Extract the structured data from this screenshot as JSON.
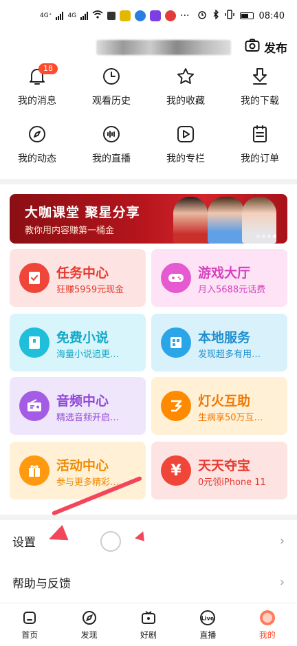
{
  "status_bar": {
    "network_1": "4G⁺",
    "network_2": "4G",
    "time": "08:40"
  },
  "header": {
    "publish_label": "发布"
  },
  "quick_actions": [
    {
      "label": "我的消息",
      "icon": "bell-icon",
      "badge": "18"
    },
    {
      "label": "观看历史",
      "icon": "clock-icon"
    },
    {
      "label": "我的收藏",
      "icon": "star-icon"
    },
    {
      "label": "我的下载",
      "icon": "download-icon"
    },
    {
      "label": "我的动态",
      "icon": "compass-icon"
    },
    {
      "label": "我的直播",
      "icon": "live-icon"
    },
    {
      "label": "我的专栏",
      "icon": "play-icon"
    },
    {
      "label": "我的订单",
      "icon": "order-icon"
    }
  ],
  "banner": {
    "title": "大咖课堂 聚星分享",
    "subtitle": "教你用内容赚第一桶金"
  },
  "tiles": [
    {
      "title": "任务中心",
      "subtitle": "狂赚5959元现金",
      "icon": "task-icon",
      "bg": "#fde4e2",
      "icon_bg": "#f0463a",
      "title_color": "#e8392f",
      "sub_color": "#e8392f"
    },
    {
      "title": "游戏大厅",
      "subtitle": "月入5688元话费",
      "icon": "gamepad-icon",
      "bg": "#fde3f5",
      "icon_bg": "#e55ad0",
      "title_color": "#d63fc0",
      "sub_color": "#d63fc0"
    },
    {
      "title": "免费小说",
      "subtitle": "海量小说追更…",
      "icon": "book-icon",
      "bg": "#d7f5fb",
      "icon_bg": "#1fbfdc",
      "title_color": "#12a9c6",
      "sub_color": "#12a9c6"
    },
    {
      "title": "本地服务",
      "subtitle": "发现超多有用…",
      "icon": "building-icon",
      "bg": "#d9f1fb",
      "icon_bg": "#2aa6e8",
      "title_color": "#1e8fd0",
      "sub_color": "#1e8fd0"
    },
    {
      "title": "音频中心",
      "subtitle": "精选音频开启…",
      "icon": "radio-icon",
      "bg": "#efe6fb",
      "icon_bg": "#a45ce6",
      "title_color": "#9047d8",
      "sub_color": "#9047d8"
    },
    {
      "title": "灯火互助",
      "subtitle": "生病享50万互…",
      "icon": "mutual-aid-icon",
      "bg": "#fff0d6",
      "icon_bg": "#ff8a00",
      "title_color": "#f07800",
      "sub_color": "#f07800"
    },
    {
      "title": "活动中心",
      "subtitle": "参与更多精彩…",
      "icon": "gift-icon",
      "bg": "#fff0d6",
      "icon_bg": "#ff9a10",
      "title_color": "#f08a00",
      "sub_color": "#f08a00"
    },
    {
      "title": "天天夺宝",
      "subtitle": "0元领iPhone 11",
      "icon": "yen-icon",
      "bg": "#fde4e2",
      "icon_bg": "#f0463a",
      "title_color": "#e8392f",
      "sub_color": "#e8392f"
    }
  ],
  "settings_list": [
    {
      "label": "设置"
    },
    {
      "label": "帮助与反馈"
    }
  ],
  "tabbar": [
    {
      "label": "首页",
      "icon": "home-icon"
    },
    {
      "label": "发现",
      "icon": "compass-icon"
    },
    {
      "label": "好剧",
      "icon": "tv-icon"
    },
    {
      "label": "直播",
      "icon": "live-badge-icon"
    },
    {
      "label": "我的",
      "icon": "profile-icon",
      "active": true
    }
  ],
  "colors": {
    "accent": "#ff4a2c",
    "annotation_arrow": "#f2465a"
  }
}
